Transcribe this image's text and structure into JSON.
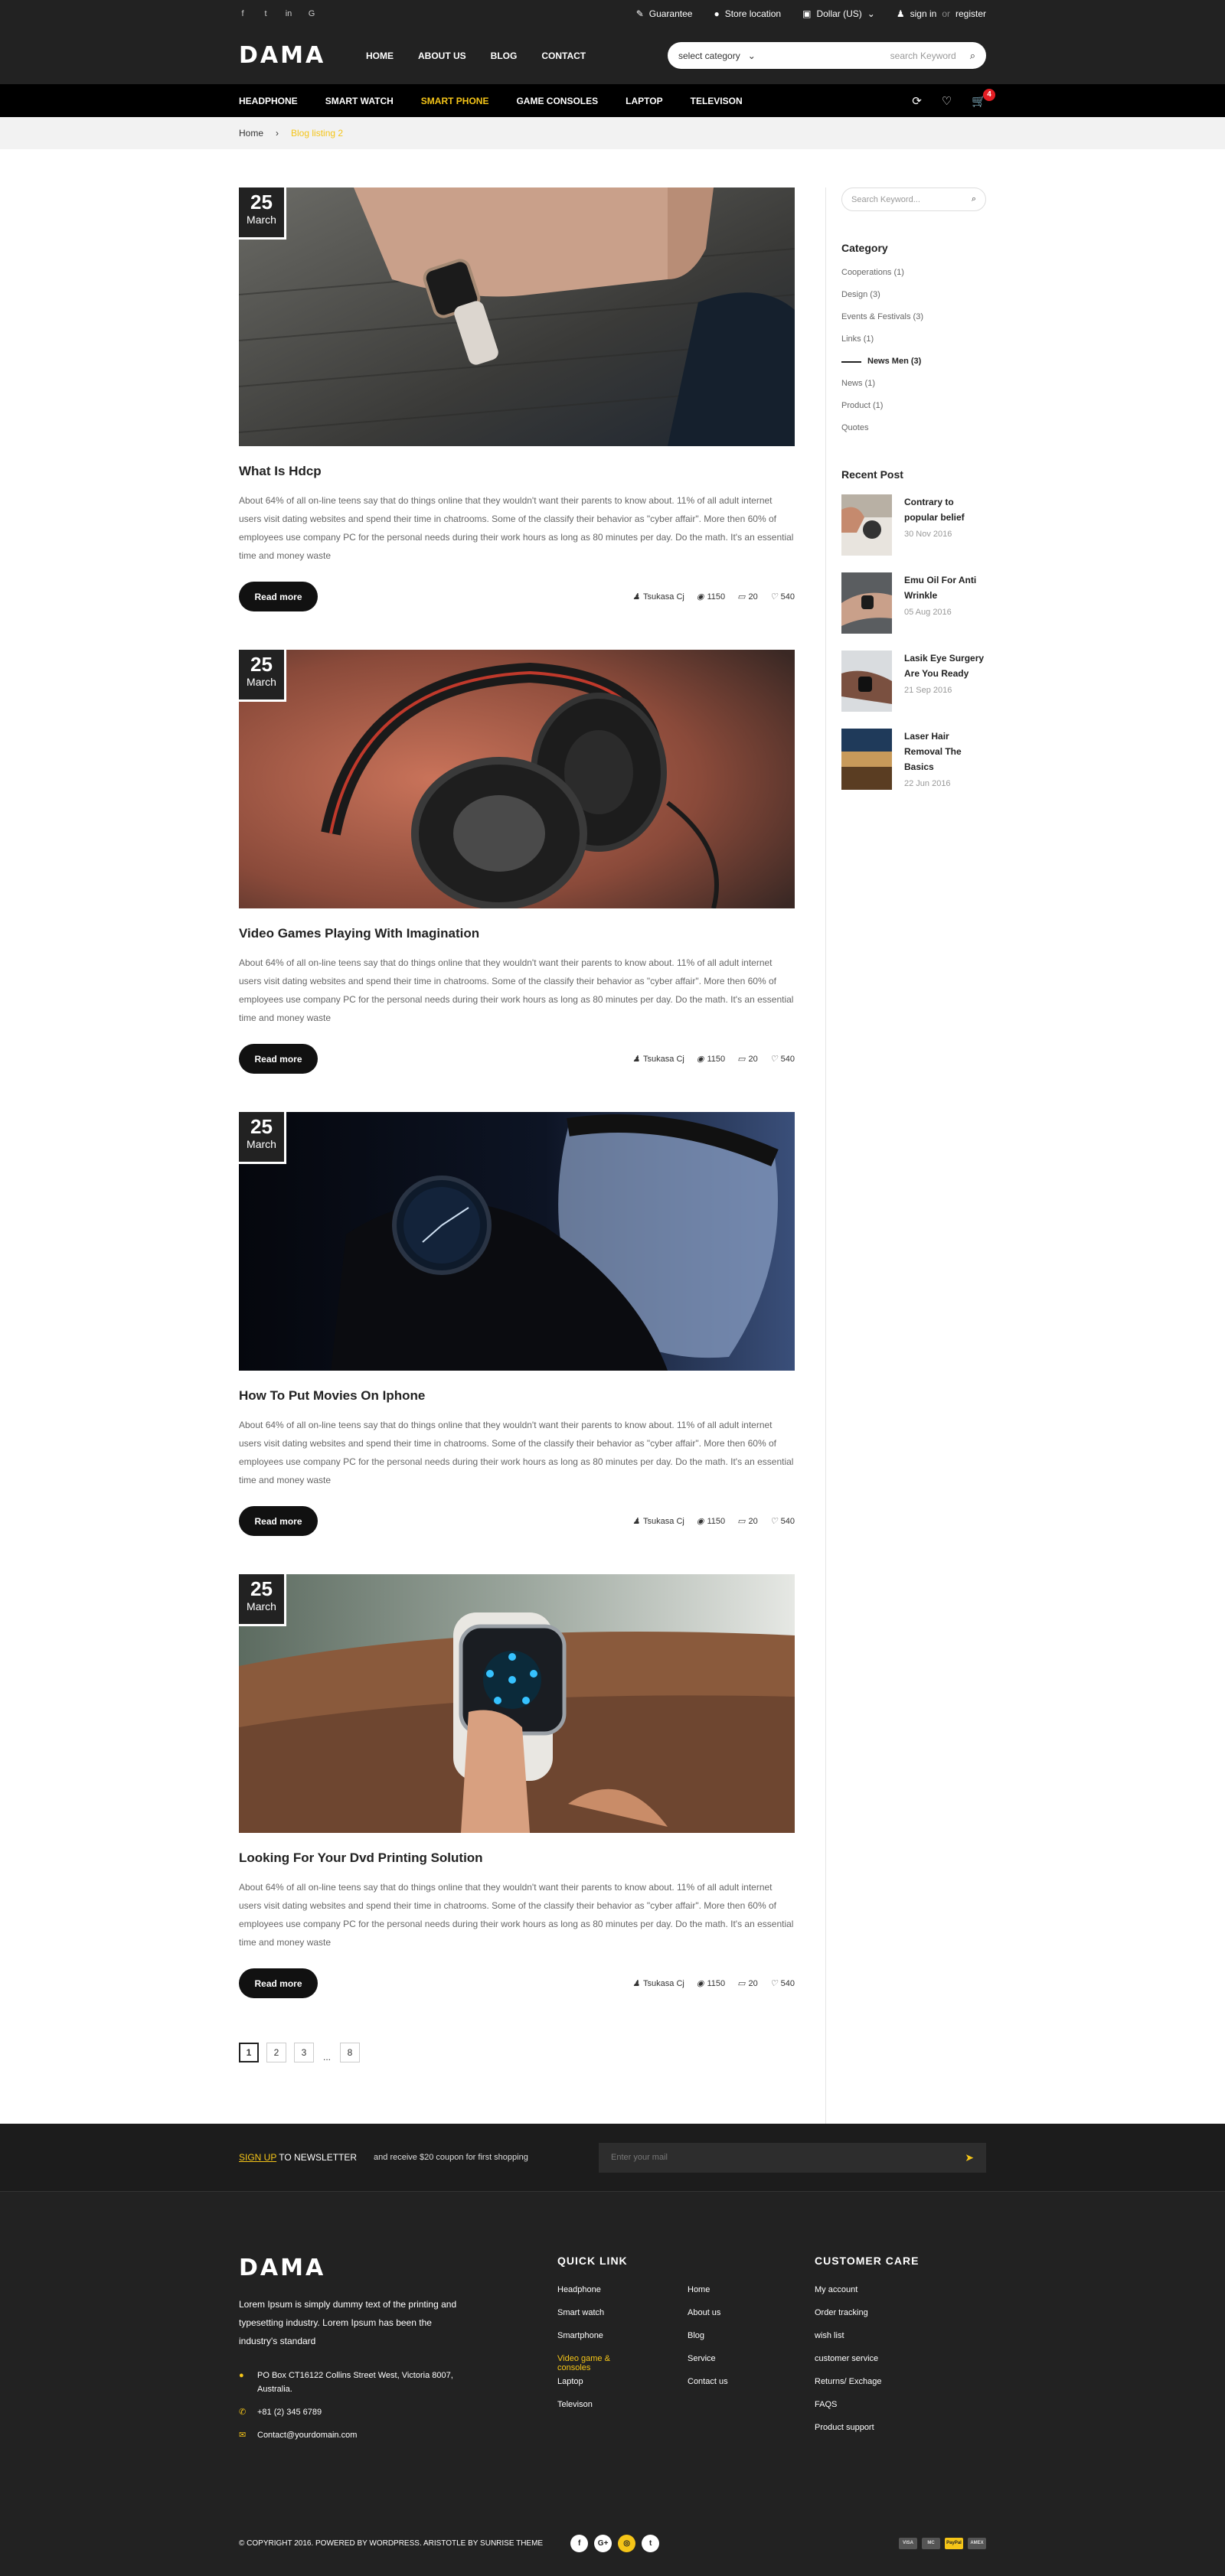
{
  "topbar": {
    "social": [
      "f",
      "t",
      "in",
      "G"
    ],
    "guarantee": "Guarantee",
    "store": "Store location",
    "currency": "Dollar (US)",
    "signin": "sign in",
    "or": "or",
    "register": "register"
  },
  "header": {
    "logo": "DAMA",
    "nav": [
      "HOME",
      "ABOUT US",
      "BLOG",
      "CONTACT"
    ],
    "search_category": "select category",
    "search_placeholder": "search Keyword"
  },
  "navbar": {
    "items": [
      "HEADPHONE",
      "SMART WATCH",
      "SMART PHONE",
      "GAME CONSOLES",
      "LAPTOP",
      "TELEVISON"
    ],
    "cart_count": "4"
  },
  "breadcrumb": {
    "home": "Home",
    "sep": "›",
    "current": "Blog listing 2"
  },
  "posts": [
    {
      "day": "25",
      "month": "March",
      "title": "What Is Hdcp",
      "excerpt": "About 64% of all on-line teens say that do things online that they wouldn't want their parents to know about.   11% of all adult internet users visit dating websites and spend their time in chatrooms. Some of the classify their behavior as \"cyber affair\".  More then 60% of employees use company PC for the personal needs during their work hours as long as 80 minutes per day. Do the math. It's an essential time and money waste",
      "read_more": "Read more",
      "author": "Tsukasa Cj",
      "views": "1150",
      "comments": "20",
      "likes": "540"
    },
    {
      "day": "25",
      "month": "March",
      "title": "Video Games Playing With Imagination",
      "excerpt": "About 64% of all on-line teens say that do things online that they wouldn't want their parents to know about.   11% of all adult internet users visit dating websites and spend their time in chatrooms. Some of the classify their behavior as \"cyber affair\".  More then 60% of employees use company PC for the personal needs during their work hours as long as 80 minutes per day. Do the math. It's an essential time and money waste",
      "read_more": "Read more",
      "author": "Tsukasa Cj",
      "views": "1150",
      "comments": "20",
      "likes": "540"
    },
    {
      "day": "25",
      "month": "March",
      "title": "How To Put Movies On Iphone",
      "excerpt": "About 64% of all on-line teens say that do things online that they wouldn't want their parents to know about.   11% of all adult internet users visit dating websites and spend their time in chatrooms. Some of the classify their behavior as \"cyber affair\".  More then 60% of employees use company PC for the personal needs during their work hours as long as 80 minutes per day. Do the math. It's an essential time and money waste",
      "read_more": "Read more",
      "author": "Tsukasa Cj",
      "views": "1150",
      "comments": "20",
      "likes": "540"
    },
    {
      "day": "25",
      "month": "March",
      "title": "Looking For Your Dvd Printing Solution",
      "excerpt": "About 64% of all on-line teens say that do things online that they wouldn't want their parents to know about.   11% of all adult internet users visit dating websites and spend their time in chatrooms. Some of the classify their behavior as \"cyber affair\".  More then 60% of employees use company PC for the personal needs during their work hours as long as 80 minutes per day. Do the math. It's an essential time and money waste",
      "read_more": "Read more",
      "author": "Tsukasa Cj",
      "views": "1150",
      "comments": "20",
      "likes": "540"
    }
  ],
  "pagination": [
    "1",
    "2",
    "3",
    "...",
    "8"
  ],
  "sidebar": {
    "search_placeholder": "Search Keyword...",
    "category_title": "Category",
    "categories": [
      "Cooperations (1)",
      "Design (3)",
      "Events & Festivals (3)",
      "Links (1)",
      "News Men (3)",
      "News (1)",
      "Product (1)",
      "Quotes"
    ],
    "recent_title": "Recent Post",
    "recent": [
      {
        "title": "Contrary to popular belief",
        "date": "30 Nov 2016"
      },
      {
        "title": "Emu Oil For Anti Wrinkle",
        "date": "05 Aug 2016"
      },
      {
        "title": "Lasik Eye Surgery Are You Ready",
        "date": "21 Sep 2016"
      },
      {
        "title": "Laser Hair Removal The Basics",
        "date": "22 Jun 2016"
      }
    ]
  },
  "newsletter": {
    "signup": "SIGN UP",
    "to": " TO NEWSLETTER",
    "sub": "and receive $20 coupon for first shopping",
    "placeholder": "Enter your mail"
  },
  "footer": {
    "logo": "DAMA",
    "about": "Lorem Ipsum is simply dummy text of the printing and typesetting industry. Lorem Ipsum has been the industry's standard",
    "address": "PO Box CT16122 Collins Street West, Victoria 8007, Australia.",
    "phone": "+81 (2) 345 6789",
    "email": "Contact@yourdomain.com",
    "quick_title": "QUICK LINK",
    "quick_col1": [
      "Headphone",
      "Smart watch",
      "Smartphone",
      "Video game & consoles",
      "Laptop",
      "Televison"
    ],
    "quick_col2": [
      "Home",
      "About us",
      "Blog",
      "Service",
      "Contact us"
    ],
    "care_title": "CUSTOMER CARE",
    "care": [
      "My account",
      "Order tracking",
      "wish list",
      "customer service",
      "Returns/ Exchage",
      "FAQS",
      "Product support"
    ],
    "copyright": "© COPYRIGHT 2016. POWERED BY WORDPRESS. ARISTOTLE  BY SUNRISE THEME",
    "social": [
      "f",
      "G+",
      "◎",
      "t"
    ],
    "payments": [
      "VISA",
      "MC",
      "PayPal",
      "AMEX"
    ]
  },
  "colors": {
    "accent": "#f5c518",
    "dark": "#222222",
    "badge": "#e31e24"
  }
}
